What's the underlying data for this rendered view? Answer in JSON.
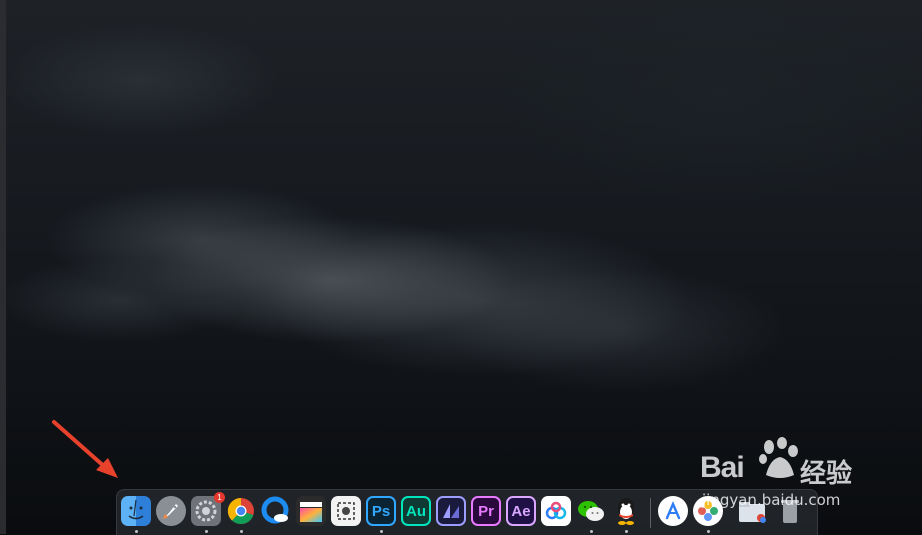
{
  "wallpaper": {
    "description_color_top": "#1e2227",
    "description_color_bottom": "#0a0c0f"
  },
  "annotation": {
    "arrow_color": "#e8412c"
  },
  "dock": {
    "apps": [
      {
        "name": "finder-icon",
        "label": "",
        "bg": "#3a8ee6",
        "running": true
      },
      {
        "name": "launchpad-icon",
        "label": "",
        "bg": "#8a8f96",
        "running": false
      },
      {
        "name": "system-preferences-icon",
        "label": "",
        "bg": "#7b7f85",
        "running": true,
        "badge": "1"
      },
      {
        "name": "chrome-icon",
        "label": "",
        "bg": "#ffffff",
        "running": true
      },
      {
        "name": "qq-browser-icon",
        "label": "",
        "bg": "#1d8cf0",
        "running": false
      },
      {
        "name": "final-cut-pro-icon",
        "label": "",
        "bg": "#2b2b2b",
        "running": false
      },
      {
        "name": "screenshot-app-icon",
        "label": "",
        "bg": "#f2f2f2",
        "running": false
      },
      {
        "name": "photoshop-icon",
        "label": "Ps",
        "bg": "#0b2433",
        "fg": "#31a8ff",
        "running": true
      },
      {
        "name": "audition-icon",
        "label": "Au",
        "bg": "#0f3a34",
        "fg": "#00e4bb",
        "running": false
      },
      {
        "name": "media-encoder-icon",
        "label": "",
        "bg": "#1a1a3d",
        "fg": "#9d9dff",
        "running": false
      },
      {
        "name": "premiere-pro-icon",
        "label": "Pr",
        "bg": "#2a0a3d",
        "fg": "#e77aff",
        "running": false
      },
      {
        "name": "after-effects-icon",
        "label": "Ae",
        "bg": "#1f1046",
        "fg": "#d9a7ff",
        "running": false
      },
      {
        "name": "baidu-netdisk-icon",
        "label": "",
        "bg": "#ffffff",
        "running": false
      },
      {
        "name": "wechat-icon",
        "label": "",
        "bg": "transparent",
        "running": true
      },
      {
        "name": "qq-icon",
        "label": "",
        "bg": "transparent",
        "running": true
      },
      {
        "name": "app-store-icon",
        "label": "",
        "bg": "#ffffff",
        "running": false
      },
      {
        "name": "photos-icon",
        "label": "",
        "bg": "#ffffff",
        "running": true
      },
      {
        "name": "folder-icon",
        "label": "",
        "bg": "#dde3ea",
        "running": false
      },
      {
        "name": "trash-icon",
        "label": "",
        "bg": "#9aa0a6",
        "running": false
      }
    ]
  },
  "watermark": {
    "brand_left": "Bai",
    "brand_right": "经验",
    "url": "jingyan.baidu.com"
  }
}
